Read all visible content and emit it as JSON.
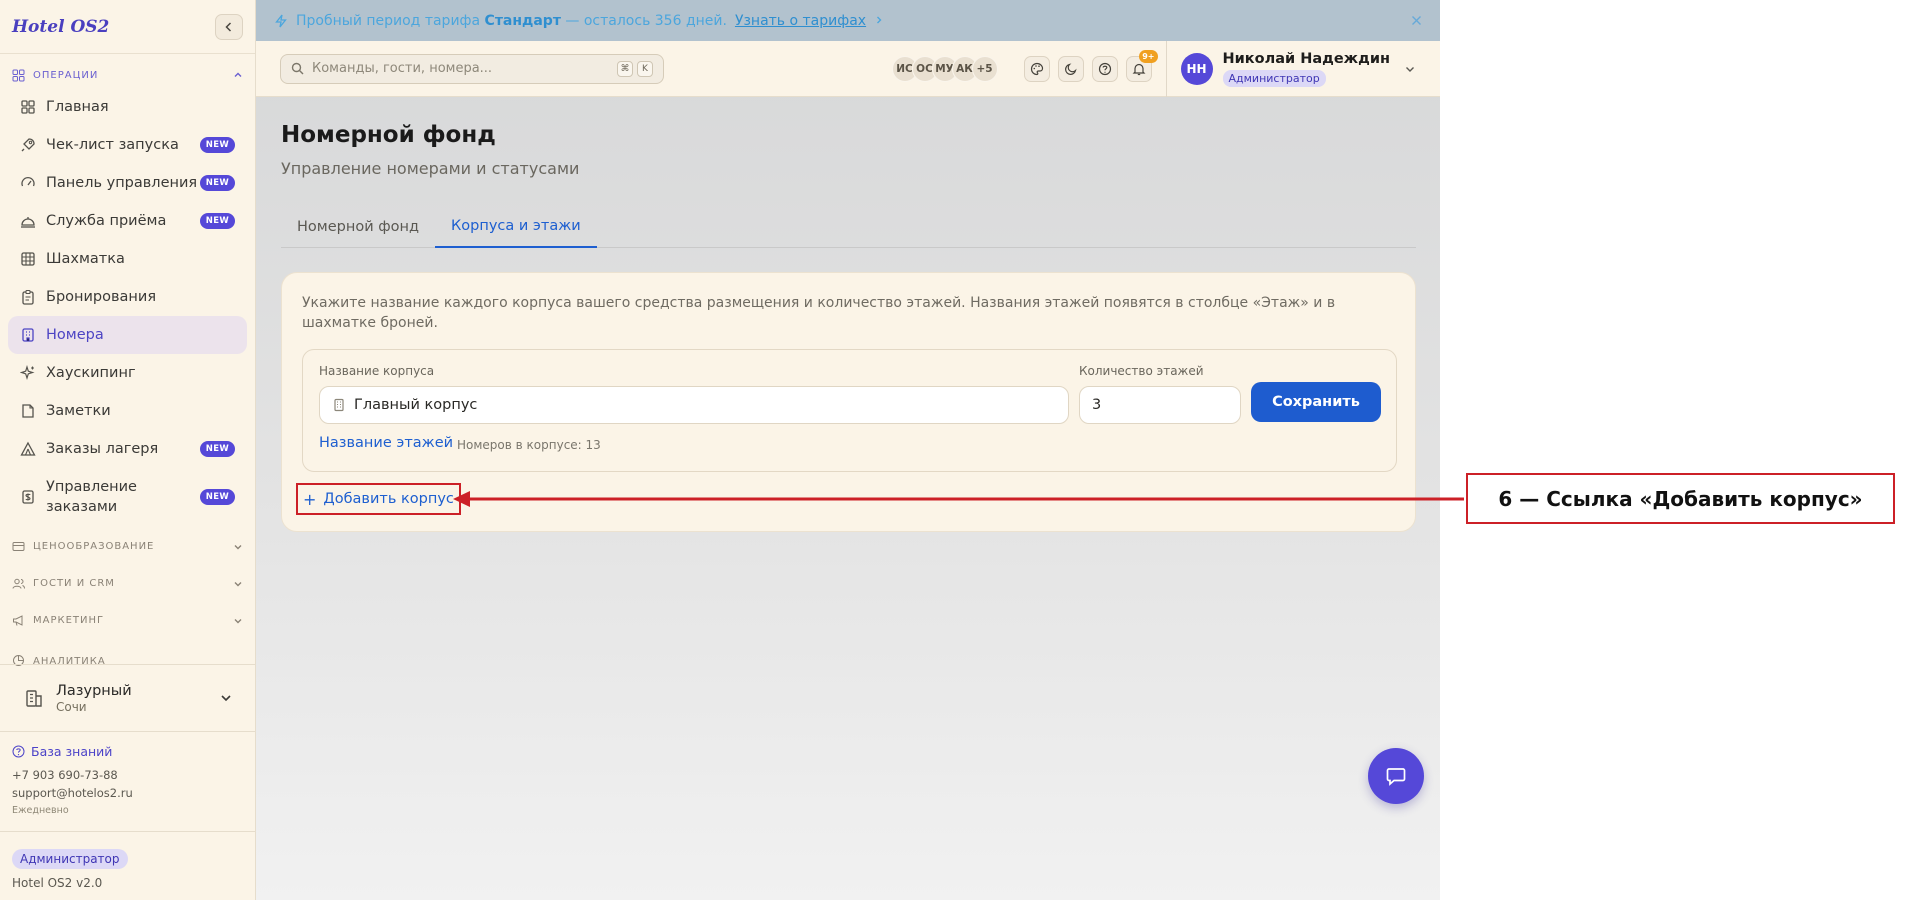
{
  "sidebar": {
    "brand": "Hotel OS2",
    "section_operations": "Операции",
    "items": [
      {
        "label": "Главная",
        "badge": ""
      },
      {
        "label": "Чек-лист запуска",
        "badge": "NEW"
      },
      {
        "label": "Панель управления",
        "badge": "NEW"
      },
      {
        "label": "Служба приёма",
        "badge": "NEW"
      },
      {
        "label": "Шахматка",
        "badge": ""
      },
      {
        "label": "Бронирования",
        "badge": ""
      },
      {
        "label": "Номера",
        "badge": ""
      },
      {
        "label": "Хаускипинг",
        "badge": ""
      },
      {
        "label": "Заметки",
        "badge": ""
      },
      {
        "label": "Заказы лагеря",
        "badge": "NEW"
      },
      {
        "label": "Управление заказами",
        "badge": "NEW"
      }
    ],
    "sections": [
      "Ценообразование",
      "Гости и CRM",
      "Маркетинг",
      "Аналитика"
    ],
    "hotel": {
      "name": "Лазурный",
      "city": "Сочи"
    },
    "support": {
      "kb": "База знаний",
      "phone": "+7 903 690-73-88",
      "email": "support@hotelos2.ru",
      "hours": "Ежедневно"
    },
    "role": "Администратор",
    "version": "Hotel OS2 v2.0"
  },
  "promo": {
    "prefix": "Пробный период тарифа",
    "plan": "Стандарт",
    "suffix": "— осталось 356 дней.",
    "link": "Узнать о тарифах"
  },
  "topbar": {
    "search_placeholder": "Команды, гости, номера...",
    "kbd_cmd": "⌘",
    "kbd_k": "K",
    "avatars": [
      "ИС",
      "ОС",
      "МУ",
      "АК",
      "+5"
    ],
    "notif_count": "9+",
    "user": {
      "initials": "НН",
      "name": "Николай Надеждин",
      "role": "Администратор"
    }
  },
  "page": {
    "title": "Номерной фонд",
    "subtitle": "Управление номерами и статусами",
    "tabs": [
      {
        "label": "Номерной фонд",
        "active": false
      },
      {
        "label": "Корпуса и этажи",
        "active": true
      }
    ],
    "description": "Укажите название каждого корпуса вашего средства размещения и количество этажей. Названия этажей появятся в столбце «Этаж» и в шахматке броней.",
    "building": {
      "name_label": "Название корпуса",
      "name_value": "Главный корпус",
      "floors_label": "Количество этажей",
      "floors_value": "3",
      "save": "Сохранить",
      "floors_link": "Название этажей",
      "rooms_count": "Номеров в корпусе: 13"
    },
    "add_building": "Добавить корпус"
  },
  "annotation": {
    "text": "6 — Ссылка «Добавить корпус»",
    "color": "#cc2027"
  },
  "colors": {
    "accent": "#5548d8",
    "link": "#1e5fd0",
    "button": "#1e5ccf"
  }
}
